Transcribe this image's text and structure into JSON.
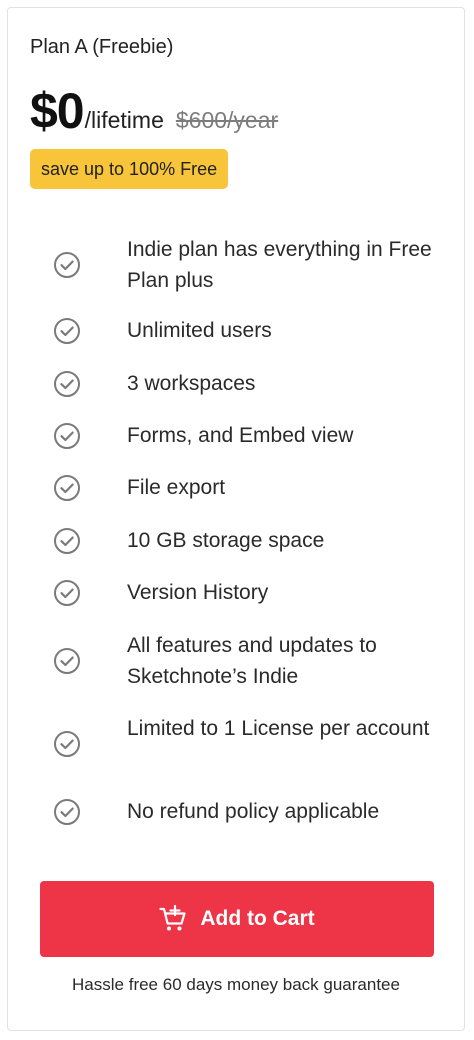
{
  "plan": {
    "name": "Plan A (Freebie)",
    "price": "$0",
    "period": "/lifetime",
    "old_price": "$600/year",
    "save_badge": "save up to 100% Free"
  },
  "features": [
    "Indie plan has everything in Free Plan plus",
    "Unlimited users",
    "3 workspaces",
    "Forms, and Embed view",
    "File export",
    "10 GB storage space",
    "Version History",
    "All features and updates to Sketchnote’s Indie",
    "Limited to 1 License per account",
    "No refund policy applicable"
  ],
  "icons": {
    "feature": "check-circle-icon",
    "cart": "add-to-cart-icon"
  },
  "cta": {
    "label": "Add to Cart"
  },
  "guarantee": "Hassle free 60 days money back guarantee",
  "colors": {
    "badge": "#f8c43a",
    "button": "#ee3548",
    "check": "#7a7a7a"
  }
}
